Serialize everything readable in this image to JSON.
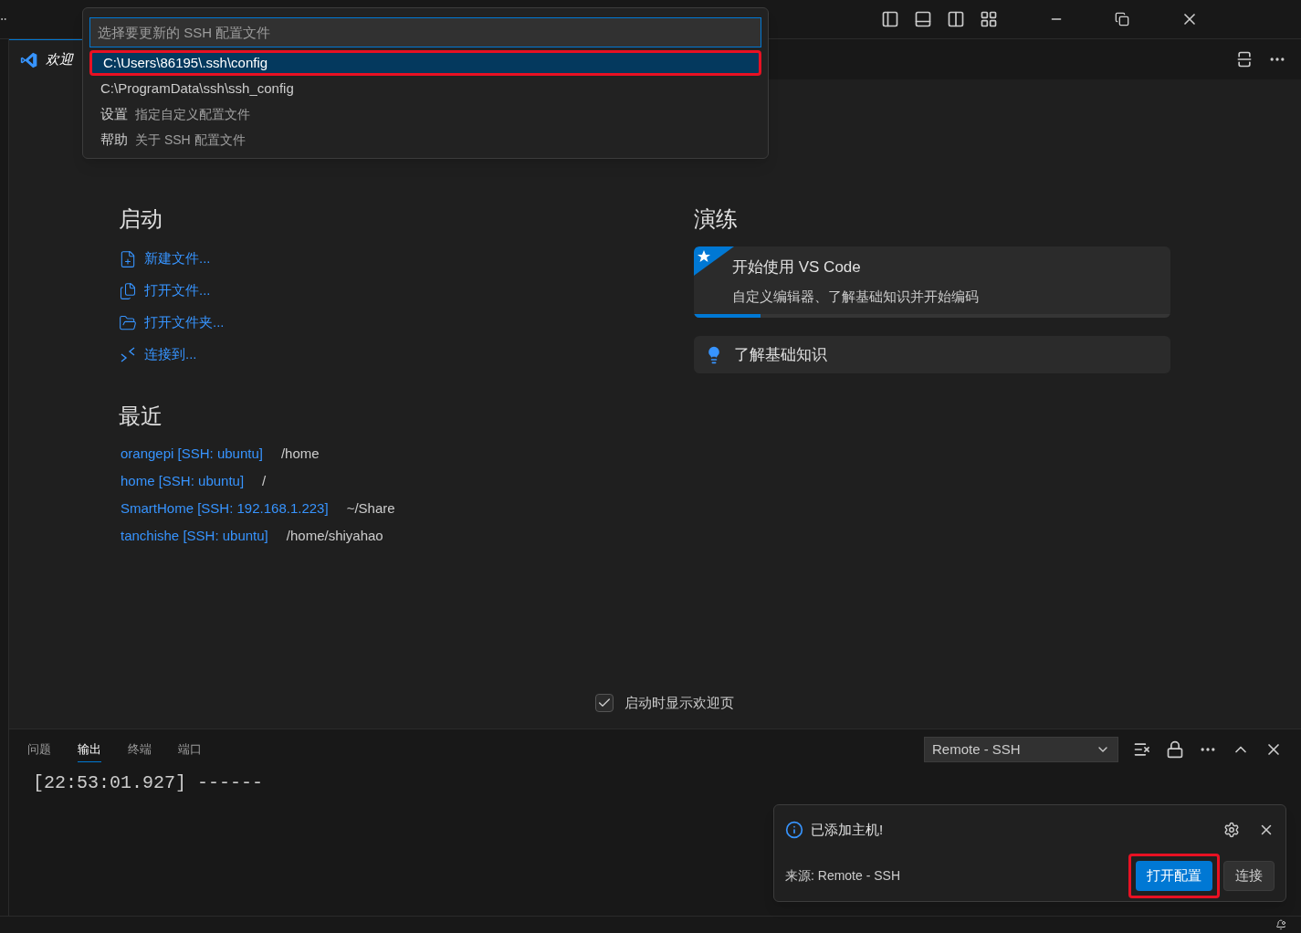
{
  "quick_pick": {
    "placeholder": "选择要更新的 SSH 配置文件",
    "items": [
      {
        "kind": "path",
        "label": "C:\\Users\\86195\\.ssh\\config",
        "selected": true,
        "highlighted": true
      },
      {
        "kind": "path",
        "label": "C:\\ProgramData\\ssh\\ssh_config",
        "selected": false,
        "highlighted": false
      },
      {
        "kind": "action",
        "label": "设置",
        "description": "指定自定义配置文件",
        "selected": false,
        "highlighted": false
      },
      {
        "kind": "action",
        "label": "帮助",
        "description": "关于 SSH 配置文件",
        "selected": false,
        "highlighted": false
      }
    ]
  },
  "tab": {
    "title": "欢迎"
  },
  "start": {
    "heading": "启动",
    "items": [
      {
        "kind": "new-file",
        "label": "新建文件..."
      },
      {
        "kind": "open-file",
        "label": "打开文件..."
      },
      {
        "kind": "open-folder",
        "label": "打开文件夹..."
      },
      {
        "kind": "connect",
        "label": "连接到..."
      }
    ]
  },
  "recent": {
    "heading": "最近",
    "items": [
      {
        "name": "orangepi [SSH: ubuntu]",
        "path": "/home"
      },
      {
        "name": "home [SSH: ubuntu]",
        "path": "/"
      },
      {
        "name": "SmartHome [SSH: 192.168.1.223]",
        "path": "~/Share"
      },
      {
        "name": "tanchishe [SSH: ubuntu]",
        "path": "/home/shiyahao"
      }
    ]
  },
  "walkthroughs": {
    "heading": "演练",
    "items": [
      {
        "kind": "featured",
        "title": "开始使用 VS Code",
        "description": "自定义编辑器、了解基础知识并开始编码",
        "level": 0.14
      },
      {
        "kind": "basic",
        "title": "了解基础知识"
      }
    ]
  },
  "show_on_startup": {
    "label": "启动时显示欢迎页",
    "checked": true
  },
  "panel": {
    "tabs": [
      {
        "label": "问题",
        "selected": false
      },
      {
        "label": "输出",
        "selected": true
      },
      {
        "label": "终端",
        "selected": false
      },
      {
        "label": "端口",
        "selected": false
      }
    ],
    "channel": "Remote - SSH",
    "output": "[22:53:01.927] ------"
  },
  "notification": {
    "message": "已添加主机!",
    "source": "来源: Remote - SSH",
    "buttons": [
      {
        "label": "打开配置",
        "primary": true,
        "highlighted": true
      },
      {
        "label": "连接",
        "primary": false,
        "highlighted": false
      }
    ]
  }
}
